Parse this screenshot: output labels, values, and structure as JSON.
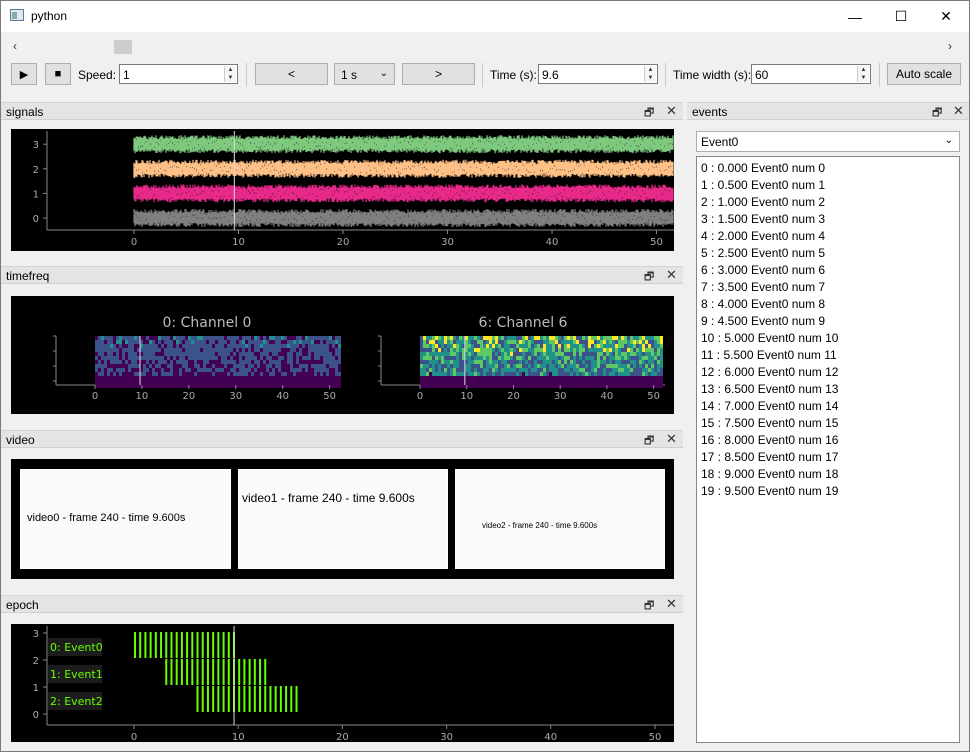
{
  "window": {
    "title": "python",
    "minimize": "—",
    "maximize": "☐",
    "close": "✕"
  },
  "scrollbar": {
    "left": "‹",
    "right": "›"
  },
  "toolbar": {
    "play": "▶",
    "stop": "■",
    "speed_label": "Speed:",
    "speed_value": "1",
    "back_label": "<",
    "step_value": "1 s",
    "forward_label": ">",
    "time_label": "Time (s):",
    "time_value": "9.6",
    "width_label": "Time width (s):",
    "width_value": "60",
    "autoscale_label": "Auto scale"
  },
  "docks": {
    "signals": "signals",
    "timefreq": "timefreq",
    "video": "video",
    "epoch": "epoch",
    "events": "events",
    "float_icon": "🗗",
    "close_icon": "✕"
  },
  "timefreq": {
    "left_title": "0: Channel 0",
    "right_title": "6: Channel 6"
  },
  "videos": [
    {
      "text": "video0 - frame   240 - time  9.600s"
    },
    {
      "text": "video1 - frame   240 - time  9.600s"
    },
    {
      "text": "video2 - frame   240 - time  9.600s"
    }
  ],
  "epoch": {
    "labels": [
      "0: Event0",
      "1: Event1",
      "2: Event2"
    ]
  },
  "events": {
    "selected": "Event0",
    "items": [
      "0 : 0.000 Event0 num 0",
      "1 : 0.500 Event0 num 1",
      "2 : 1.000 Event0 num 2",
      "3 : 1.500 Event0 num 3",
      "4 : 2.000 Event0 num 4",
      "5 : 2.500 Event0 num 5",
      "6 : 3.000 Event0 num 6",
      "7 : 3.500 Event0 num 7",
      "8 : 4.000 Event0 num 8",
      "9 : 4.500 Event0 num 9",
      "10 : 5.000 Event0 num 10",
      "11 : 5.500 Event0 num 11",
      "12 : 6.000 Event0 num 12",
      "13 : 6.500 Event0 num 13",
      "14 : 7.000 Event0 num 14",
      "15 : 7.500 Event0 num 15",
      "16 : 8.000 Event0 num 16",
      "17 : 8.500 Event0 num 17",
      "18 : 9.000 Event0 num 18",
      "19 : 9.500 Event0 num 19"
    ]
  },
  "chart_data": [
    {
      "type": "line",
      "name": "signals",
      "x_ticks": [
        0,
        10,
        20,
        30,
        40,
        50
      ],
      "y_ticks": [
        0,
        1,
        2,
        3
      ],
      "xlim": [
        -9,
        52
      ],
      "ylim": [
        -0.5,
        3.5
      ],
      "cursor_x": 9.6,
      "series": [
        {
          "channel": 0,
          "offset": 0,
          "color": "#7f7f7f"
        },
        {
          "channel": 1,
          "offset": 1,
          "color": "#e7298a"
        },
        {
          "channel": 2,
          "offset": 2,
          "color": "#fdc086"
        },
        {
          "channel": 3,
          "offset": 3,
          "color": "#7fc97f"
        }
      ],
      "data_start": 0
    },
    {
      "type": "heatmap",
      "name": "timefreq",
      "x_ticks": [
        0,
        10,
        20,
        30,
        40,
        50
      ],
      "xlim": [
        -9,
        52
      ],
      "data_start": 0,
      "cursor_x": 9.6
    },
    {
      "type": "bar",
      "name": "epoch",
      "x_ticks": [
        0,
        10,
        20,
        30,
        40,
        50
      ],
      "y_ticks": [
        0,
        1,
        2,
        3
      ],
      "xlim": [
        -9,
        52
      ],
      "ylim": [
        -0.2,
        3.2
      ],
      "cursor_x": 9.6,
      "color": "#66ff00",
      "rows": [
        {
          "label": "0: Event0",
          "y": 2,
          "start": 0,
          "count": 20,
          "step": 0.5
        },
        {
          "label": "1: Event1",
          "y": 1,
          "start": 3,
          "count": 20,
          "step": 0.5
        },
        {
          "label": "2: Event2",
          "y": 0,
          "start": 6,
          "count": 20,
          "step": 0.5
        }
      ]
    }
  ]
}
